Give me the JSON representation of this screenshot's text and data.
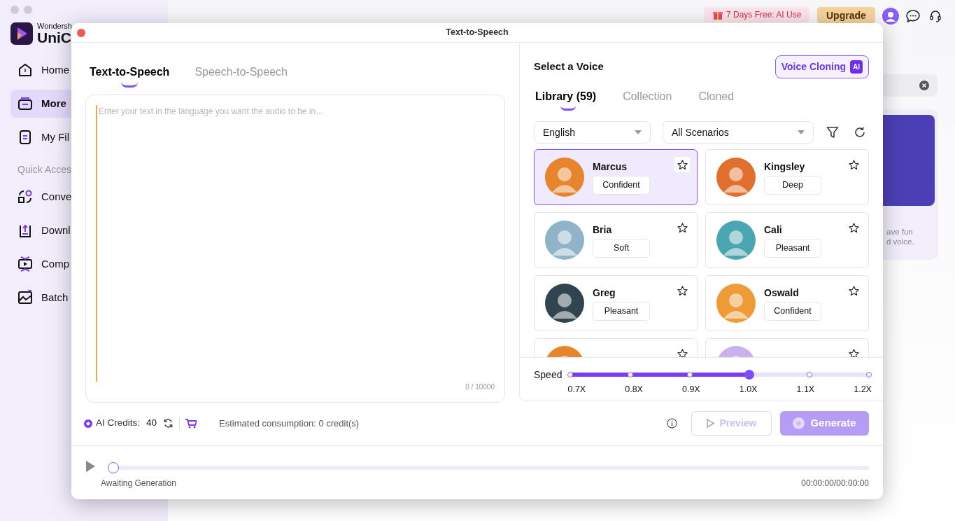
{
  "background_app": {
    "logo": {
      "brand_line": "Wondersh",
      "name": "UniC"
    },
    "sidebar": {
      "items": [
        {
          "label": "Home",
          "selected": false
        },
        {
          "label": "More",
          "selected": true
        },
        {
          "label": "My Fil",
          "selected": false
        }
      ],
      "section_label": "Quick Acces",
      "quick_access": [
        {
          "label": "Conve"
        },
        {
          "label": "Downl"
        },
        {
          "label": "Comp"
        },
        {
          "label": "Batch"
        }
      ]
    },
    "top_bar": {
      "promo": "7 Days Free: AI Use",
      "upgrade": "Upgrade"
    },
    "side_card": {
      "lines": [
        "ave fun",
        "d voice."
      ]
    }
  },
  "dialog": {
    "title": "Text-to-Speech",
    "mode_tabs": [
      {
        "label": "Text-to-Speech",
        "selected": true
      },
      {
        "label": "Speech-to-Speech",
        "selected": false
      }
    ],
    "text_input": {
      "placeholder": "Enter your text in the language you want the audio to be in...",
      "counter": "0 / 10000"
    },
    "voice_panel": {
      "heading": "Select a Voice",
      "cloning_button": "Voice Cloning",
      "cloning_badge": "AI",
      "tabs": [
        {
          "label": "Library (59)",
          "selected": true
        },
        {
          "label": "Collection",
          "selected": false
        },
        {
          "label": "Cloned",
          "selected": false
        }
      ],
      "language": "English",
      "scenario": "All Scenarios",
      "voices": [
        {
          "name": "Marcus",
          "tag": "Confident",
          "selected": true,
          "color": "#e8842c"
        },
        {
          "name": "Kingsley",
          "tag": "Deep",
          "selected": false,
          "color": "#e0702e"
        },
        {
          "name": "Bria",
          "tag": "Soft",
          "selected": false,
          "color": "#8fb3c9"
        },
        {
          "name": "Cali",
          "tag": "Pleasant",
          "selected": false,
          "color": "#4aa6b0"
        },
        {
          "name": "Greg",
          "tag": "Pleasant",
          "selected": false,
          "color": "#2f4550"
        },
        {
          "name": "Oswald",
          "tag": "Confident",
          "selected": false,
          "color": "#ee9a35"
        },
        {
          "selected": false,
          "color": "#e8842c"
        },
        {
          "selected": false,
          "color": "#c9b2ee"
        }
      ]
    },
    "speed": {
      "label": "Speed",
      "level": 0.6,
      "stops": [
        "0.7X",
        "0.8X",
        "0.9X",
        "1.0X",
        "1.1X",
        "1.2X"
      ]
    },
    "credits": {
      "label": "AI Credits:",
      "count": "40",
      "estimate": "Estimated consumption: 0 credit(s)"
    },
    "preview": {
      "label": "Preview",
      "disabled": true
    },
    "generate": {
      "label": "Generate",
      "disabled": true
    },
    "player": {
      "status": "Awaiting Generation",
      "time": "00:00:00/00:00:00",
      "level": 0
    }
  }
}
